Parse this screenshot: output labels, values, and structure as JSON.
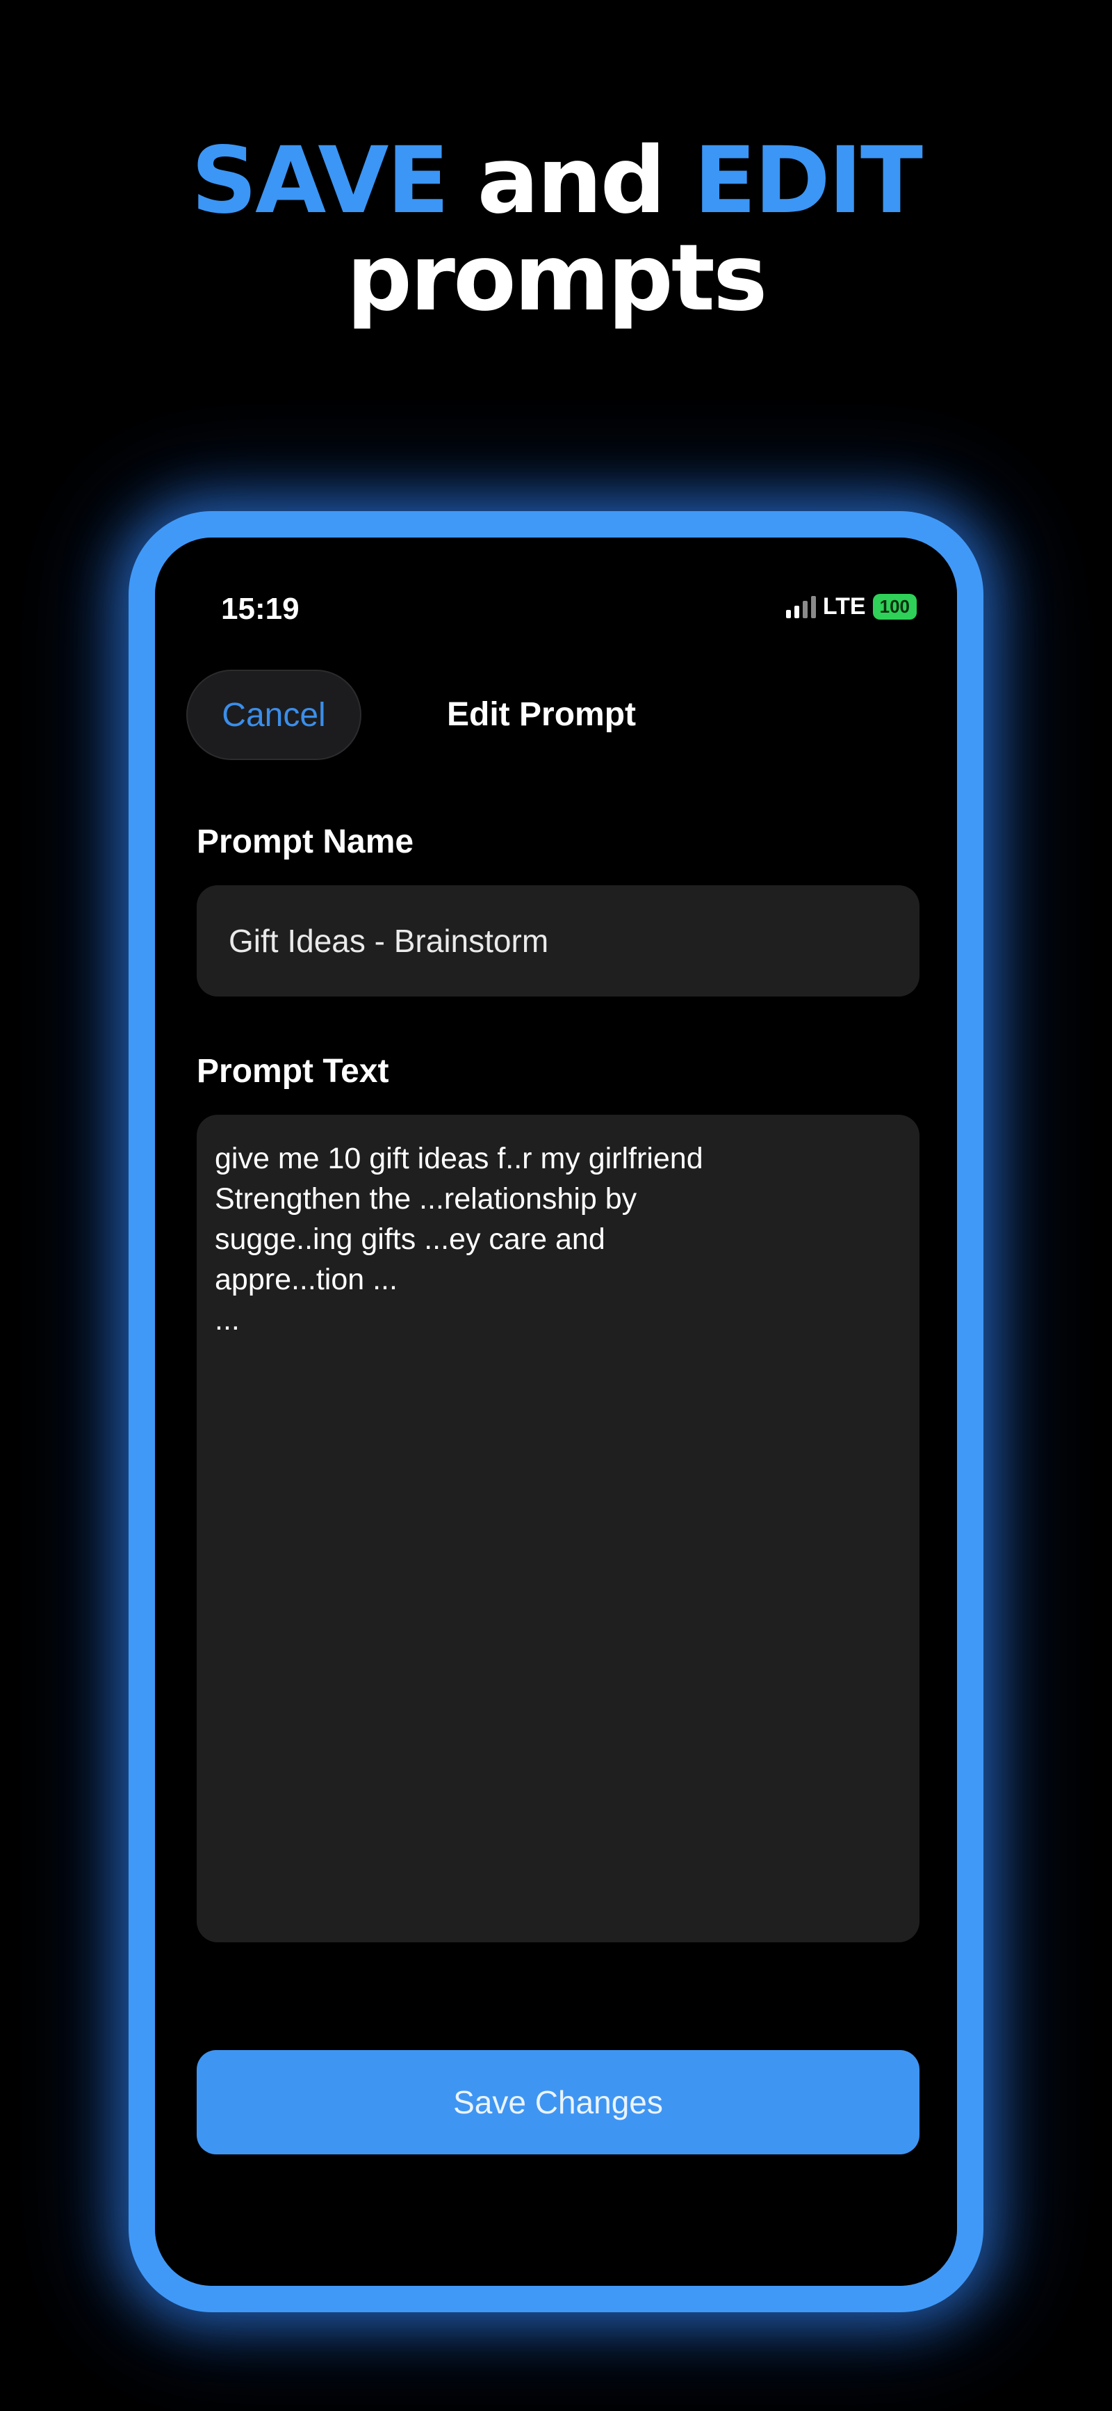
{
  "headline": {
    "word1": "SAVE",
    "word2": " and ",
    "word3": "EDIT",
    "line2": "prompts"
  },
  "status_bar": {
    "time": "15:19",
    "network": "LTE",
    "battery": "100"
  },
  "nav": {
    "cancel_label": "Cancel",
    "title": "Edit Prompt"
  },
  "form": {
    "name_label": "Prompt Name",
    "name_value": "Gift Ideas - Brainstorm",
    "text_label": "Prompt Text",
    "text_lines": [
      "give me 10 gift ideas f..r my girlfriend",
      "Strengthen the  ...relationship by",
      "sugge..ing gifts ...ey care and",
      "appre...tion ...",
      "..."
    ]
  },
  "save_label": "Save Changes",
  "colors": {
    "accent": "#3b96f5",
    "frame": "#4199f7",
    "field_bg": "#1f1f1f",
    "battery": "#2fd158"
  },
  "icons": [
    "signal-icon",
    "battery-icon"
  ]
}
